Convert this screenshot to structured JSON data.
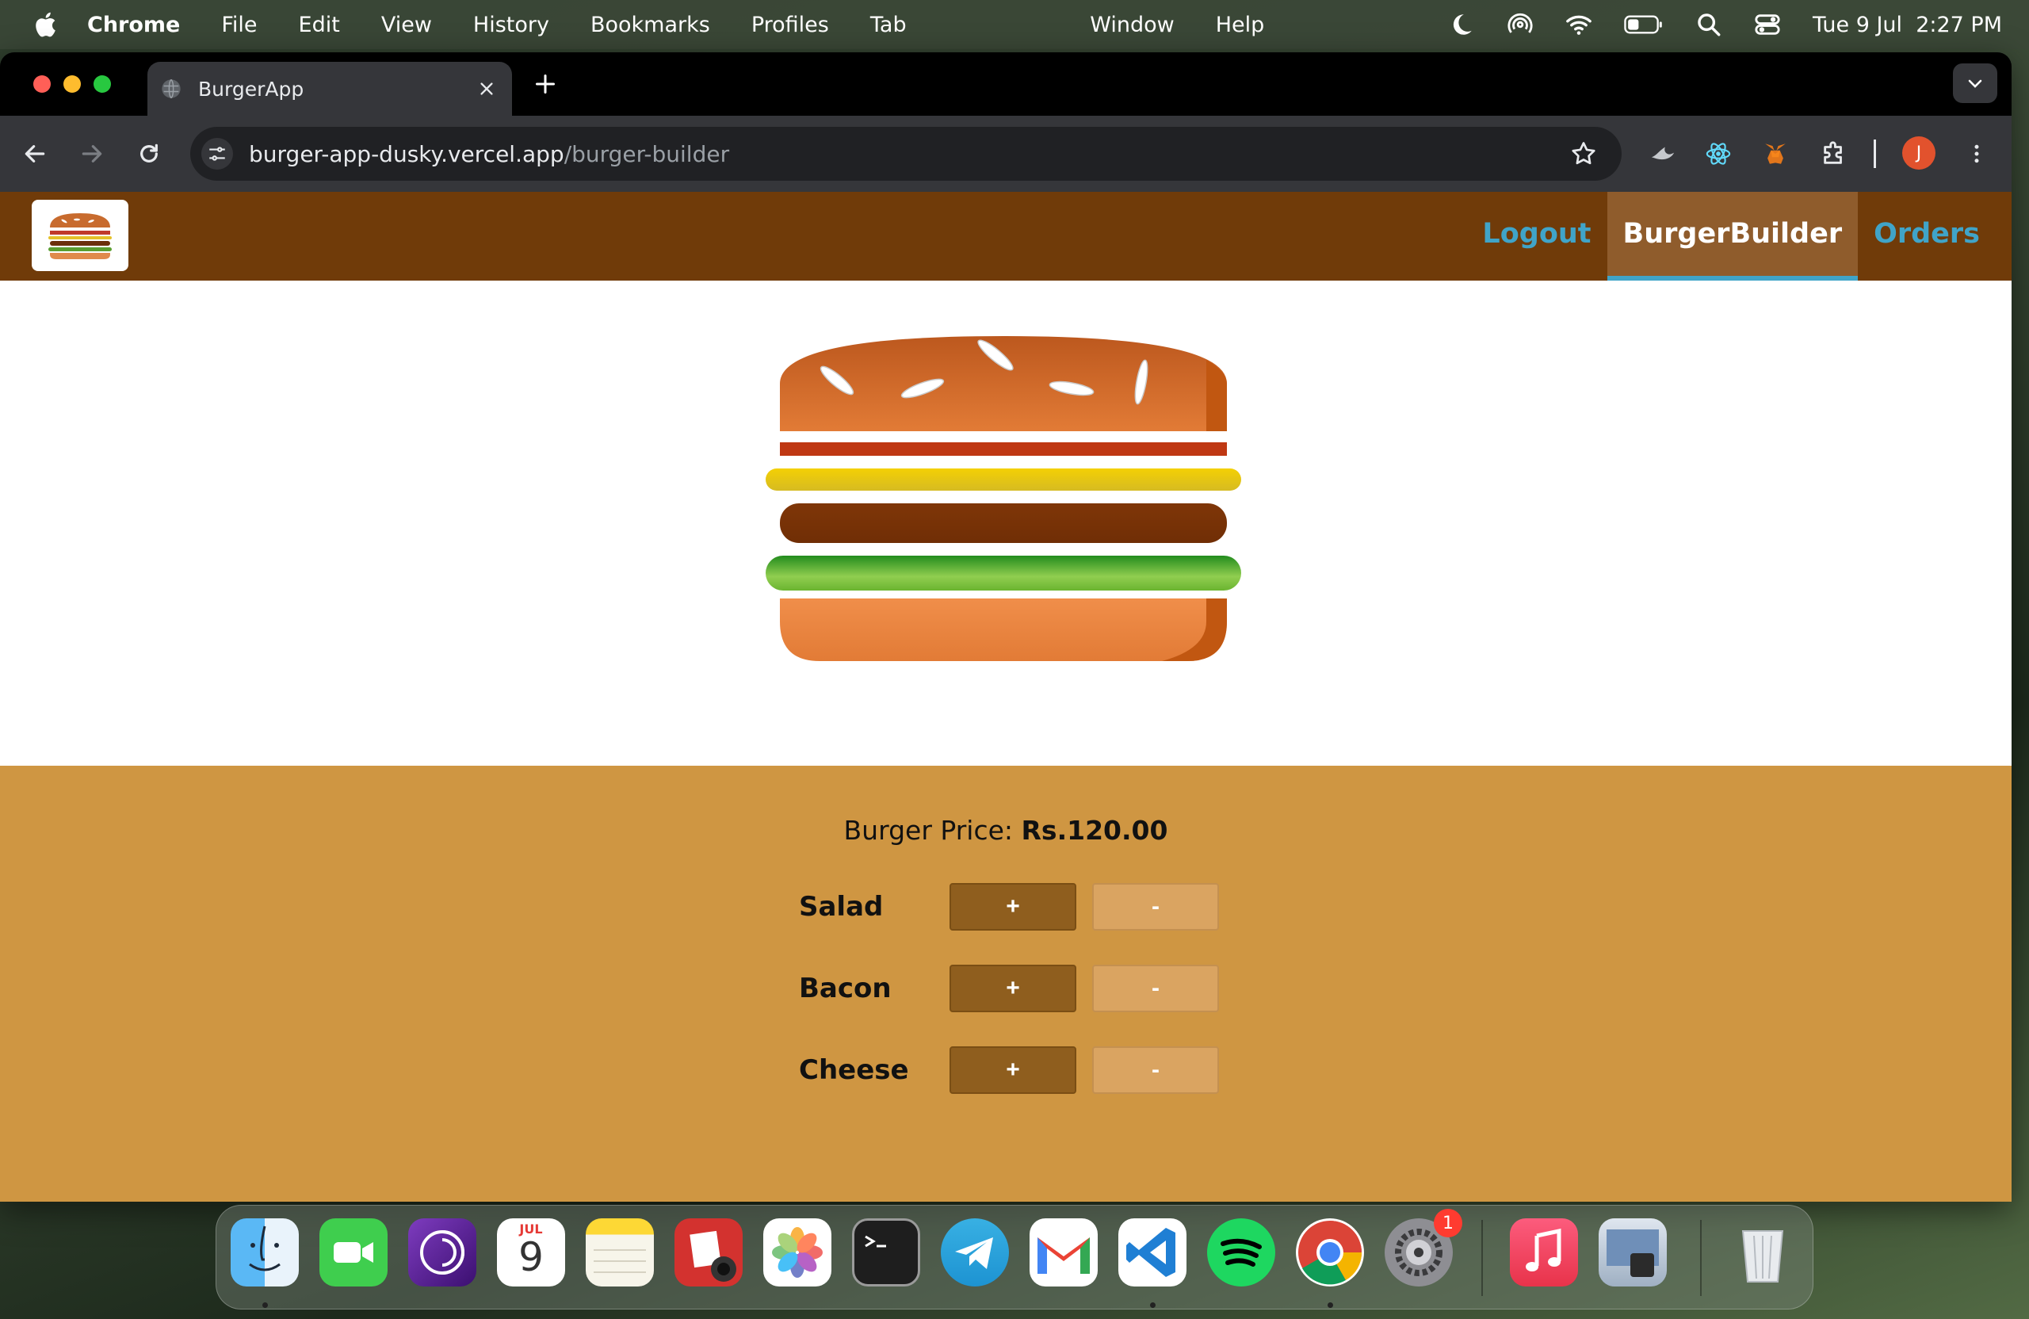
{
  "menubar": {
    "app_name": "Chrome",
    "items": [
      "File",
      "Edit",
      "View",
      "History",
      "Bookmarks",
      "Profiles",
      "Tab",
      "Window",
      "Help"
    ],
    "clock": "Tue 9 Jul  2:27 PM"
  },
  "browser": {
    "tab_title": "BurgerApp",
    "url_host": "burger-app-dusky.vercel.app",
    "url_path": "/burger-builder",
    "profile_initial": "J"
  },
  "app": {
    "nav": {
      "logout": "Logout",
      "burger_builder": "BurgerBuilder",
      "orders": "Orders",
      "active": "BurgerBuilder"
    },
    "burger_layers": [
      "bread-top",
      "meat-bacon",
      "cheese",
      "meat",
      "salad",
      "bread-bottom"
    ],
    "price_label": "Burger Price:",
    "price_value": "Rs.120.00",
    "controls": [
      {
        "label": "Salad",
        "more": "+",
        "less": "-"
      },
      {
        "label": "Bacon",
        "more": "+",
        "less": "-"
      },
      {
        "label": "Cheese",
        "more": "+",
        "less": "-"
      }
    ],
    "colors": {
      "toolbar": "#703b09",
      "controls_bg": "#cf9642",
      "nav_link": "#40a4c8",
      "more_button": "#8f5e1e",
      "less_button": "#daa461"
    }
  },
  "dock": {
    "apps": [
      "Finder",
      "FaceTime",
      "Tor Browser",
      "Calendar",
      "Notes",
      "Photo Booth",
      "Photos",
      "Terminal",
      "Telegram",
      "Gmail",
      "Visual Studio Code",
      "Spotify",
      "Google Chrome",
      "System Settings",
      "Music",
      "Preview",
      "Trash"
    ],
    "calendar_month": "JUL",
    "calendar_day": "9",
    "settings_badge": "1"
  }
}
